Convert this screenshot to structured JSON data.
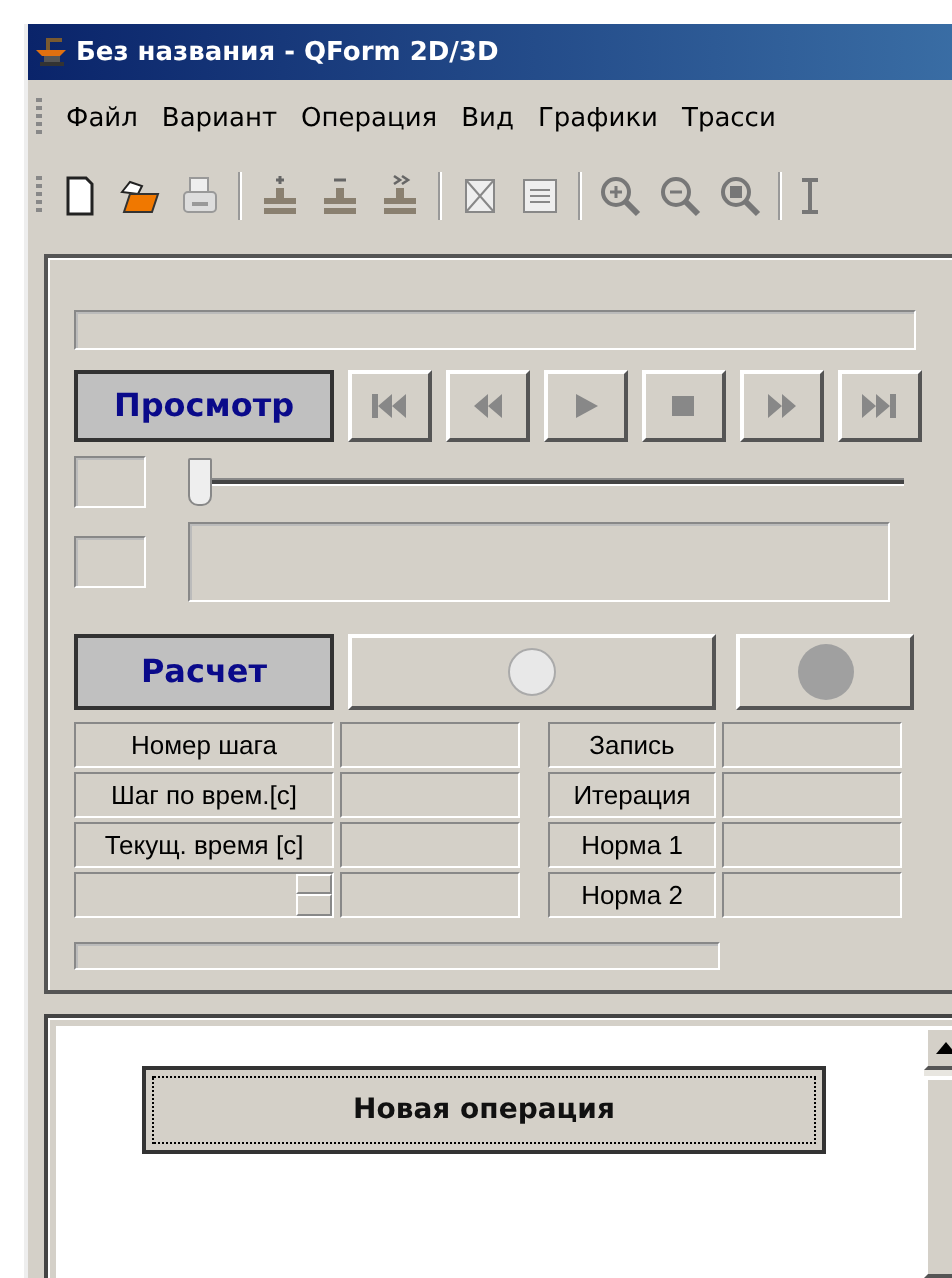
{
  "window": {
    "title": "Без названия - QForm 2D/3D"
  },
  "menu": [
    {
      "label": "Файл"
    },
    {
      "label": "Вариант"
    },
    {
      "label": "Операция"
    },
    {
      "label": "Вид"
    },
    {
      "label": "Графики"
    },
    {
      "label": "Трасси"
    }
  ],
  "view_panel": {
    "view_button": "Просмотр",
    "slider": {
      "level": 0
    }
  },
  "calc_panel": {
    "calc_button": "Расчет",
    "left_labels": [
      "Номер шага",
      "Шаг по врем.[с]",
      "Текущ. время [с]"
    ],
    "right_labels": [
      "Запись",
      "Итерация",
      "Норма 1",
      "Норма 2"
    ]
  },
  "operations": {
    "button": "Новая операция"
  }
}
